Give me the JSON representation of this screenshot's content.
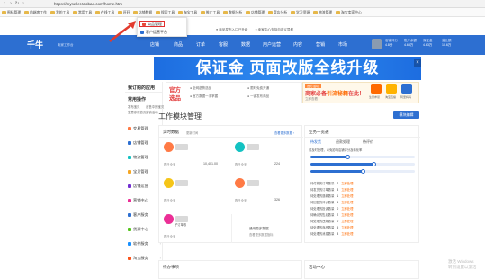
{
  "browser": {
    "url": "https://myseller.taobao.com/home.htm",
    "bookmarks": [
      "图标管理",
      "前端库工作",
      "我的工具",
      "常用工具",
      "在线工具",
      "旺旺",
      "店铺数据",
      "搜索工具",
      "淘宝工具",
      "推广工具",
      "数据分析",
      "店铺管理",
      "竞店分析",
      "学习资源",
      "物流管理",
      "淘宝卖家中心"
    ]
  },
  "popup": {
    "items": [
      "商品管理",
      "客户运营平台"
    ],
    "colors": {
      "item1": "#e84a3a",
      "item2": "#2d6fd1",
      "highlight": "#e03030"
    }
  },
  "tip_bar": {
    "items": [
      "● 商品发布入口已升级",
      "● 卖家中心支持自定义导航"
    ]
  },
  "header": {
    "logo": "千牛",
    "logo_sub": "卖家工作台",
    "nav": [
      "店铺",
      "商品",
      "订单",
      "客服",
      "数据",
      "用户运营",
      "内容",
      "营销",
      "市场"
    ],
    "stats": [
      {
        "label": "店铺评分",
        "value": "4.8分"
      },
      {
        "label": "账户余额",
        "value": "4.63万"
      },
      {
        "label": "保证金",
        "value": "4.63万"
      },
      {
        "label": "营业额",
        "value": "10.6万"
      }
    ],
    "color": "#2d6fd1"
  },
  "banner": {
    "text": "保证金 页面改版全线升级",
    "close": "×"
  },
  "sidebar": {
    "recent_title": "我订购的应用",
    "common_title": "常用操作",
    "common_links": [
      [
        "发布宝贝",
        "出售中的宝贝"
      ],
      [
        "生意参谋首页",
        "营销活动"
      ],
      [
        "",
        ""
      ]
    ],
    "items": [
      {
        "label": "交易管理",
        "color": "#ff7a45"
      },
      {
        "label": "店铺管理",
        "color": "#2d6fd1"
      },
      {
        "label": "物流管理",
        "color": "#13c2c2"
      },
      {
        "label": "宝贝管理",
        "color": "#f5a623"
      },
      {
        "label": "店铺运营",
        "color": "#722ed1"
      },
      {
        "label": "营销中心",
        "color": "#eb2f96"
      },
      {
        "label": "客户服务",
        "color": "#2d6fd1"
      },
      {
        "label": "货源中心",
        "color": "#52c41a"
      },
      {
        "label": "软件服务",
        "color": "#1890ff"
      },
      {
        "label": "淘宝服务",
        "color": "#fa541c"
      }
    ]
  },
  "ad": {
    "line1": "官方",
    "line2": "选品",
    "bullets": [
      "● 全网趋势选品",
      "● 官方数据一手掌握",
      "● 限时免费开通",
      "● 一键发布商品"
    ]
  },
  "ad2": {
    "tag": "官方活动",
    "title": "商家必备",
    "title_highlight": "引流秘籍",
    "title_tail": "在此！",
    "sub": "立即查看",
    "icons": [
      "生意参谋",
      "淘宝直播",
      "阿里妈妈"
    ],
    "icon_colors": [
      "#ff6a00",
      "#ffb300",
      "#2d6fd1"
    ]
  },
  "main": {
    "page_title": "工作模块管理",
    "edit_button": "模块编辑"
  },
  "realtime": {
    "title": "实时数据",
    "dropdown": "更新时间",
    "link": "查看更多数据 ›",
    "metrics": [
      {
        "label": "昨日全天",
        "value": "10,401.00",
        "color": "#ff7a45"
      },
      {
        "label": "昨日全天",
        "value": "224",
        "color": "#13c2c2"
      },
      {
        "label": "昨日全天",
        "value": "",
        "color": "#f5c518"
      },
      {
        "label": "昨日全天",
        "value": "326",
        "color": "#ff7a45"
      },
      {
        "label": "昨日全天",
        "value": "",
        "color": "#eb2f96"
      }
    ],
    "footer_label": "子订单数",
    "side_note_title": "通用更多数据",
    "side_note_sub": "查看更多数据指标"
  },
  "biz": {
    "title": "业务一览通",
    "tabs": [
      "待发货",
      "退款处理",
      "待评价"
    ],
    "desc": "请及时处理，以免影响店铺评分及转化率",
    "sliders": [
      0.35,
      0.6,
      0.5
    ],
    "lines": [
      [
        "待付款的订单数量",
        "2",
        "立即处理"
      ],
      [
        "待发货的订单数量",
        "3",
        "立即处理"
      ],
      [
        "待处理的退款数量",
        "1",
        "立即处理"
      ],
      [
        "待回复的评价数量",
        "6",
        "立即处理"
      ],
      [
        "待处理的投诉数量",
        "0",
        "立即处理"
      ],
      [
        "待确认的售后数量",
        "2",
        "立即处理"
      ],
      [
        "待处理的违规数量",
        "0",
        "立即处理"
      ],
      [
        "待处理的商品数量",
        "5",
        "立即处理"
      ],
      [
        "待处理的消息数量",
        "8",
        "立即处理"
      ]
    ]
  },
  "todo": {
    "title": "待办事项"
  },
  "info": {
    "title": "活动中心"
  },
  "watermark": [
    "激活 Windows",
    "转到设置以激活"
  ]
}
